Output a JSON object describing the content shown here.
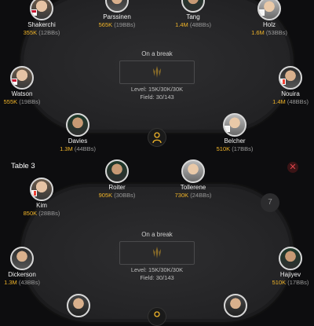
{
  "table1": {
    "break_label": "On a break",
    "level": "Level: 15K/30K/30K",
    "field": "Field: 30/143",
    "seats": [
      {
        "name": "Shakerchi",
        "stack": "355K",
        "bbs": "(12BBs)"
      },
      {
        "name": "Parssinen",
        "stack": "565K",
        "bbs": "(19BBs)"
      },
      {
        "name": "Tang",
        "stack": "1.4M",
        "bbs": "(48BBs)"
      },
      {
        "name": "Holz",
        "stack": "1.6M",
        "bbs": "(53BBs)"
      },
      {
        "name": "Watson",
        "stack": "555K",
        "bbs": "(19BBs)"
      },
      {
        "name": "Nouira",
        "stack": "1.4M",
        "bbs": "(48BBs)"
      },
      {
        "name": "Davies",
        "stack": "1.3M",
        "bbs": "(44BBs)"
      },
      {
        "name": "Belcher",
        "stack": "510K",
        "bbs": "(17BBs)"
      }
    ]
  },
  "table3": {
    "title": "Table 3",
    "close_symbol": "✕",
    "empty_seat_number": "7",
    "break_label": "On a break",
    "level": "Level: 15K/30K/30K",
    "field": "Field: 30/143",
    "seats": [
      {
        "name": "Kim",
        "stack": "850K",
        "bbs": "(28BBs)"
      },
      {
        "name": "Roiter",
        "stack": "905K",
        "bbs": "(30BBs)"
      },
      {
        "name": "Tollerene",
        "stack": "730K",
        "bbs": "(24BBs)"
      },
      {
        "name": "Dickerson",
        "stack": "1.3M",
        "bbs": "(43BBs)"
      },
      {
        "name": "Hajiyev",
        "stack": "510K",
        "bbs": "(17BBs)"
      }
    ]
  },
  "colors": {
    "accent_gold": "#f0b429",
    "close_red": "#e0454c",
    "background": "#0d0d0f"
  },
  "icons": [
    "table-logo-icon",
    "dealer-icon",
    "close-icon"
  ]
}
